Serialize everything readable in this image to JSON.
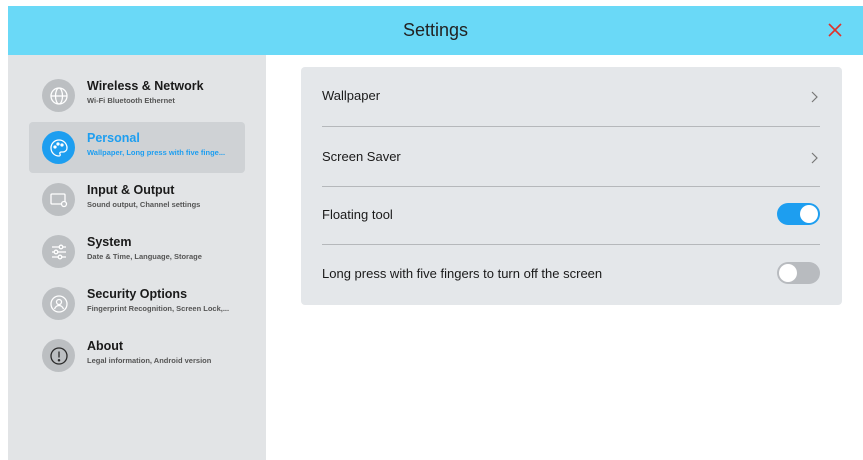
{
  "window": {
    "title": "Settings",
    "close_icon": "close-icon",
    "accent": "#1d9ef0",
    "titlebar_color": "#6ad9f7",
    "close_color": "#e0322b"
  },
  "sidebar": {
    "items": [
      {
        "label": "Wireless & Network",
        "subtitle": "Wi-Fi Bluetooth Ethernet",
        "icon": "globe-icon",
        "active": false
      },
      {
        "label": "Personal",
        "subtitle": "Wallpaper, Long press with five finge...",
        "icon": "palette-icon",
        "active": true
      },
      {
        "label": "Input & Output",
        "subtitle": "Sound output, Channel settings",
        "icon": "monitor-settings-icon",
        "active": false
      },
      {
        "label": "System",
        "subtitle": "Date & Time, Language, Storage",
        "icon": "sliders-icon",
        "active": false
      },
      {
        "label": "Security Options",
        "subtitle": "Fingerprint Recognition, Screen Lock,...",
        "icon": "user-lock-icon",
        "active": false
      },
      {
        "label": "About",
        "subtitle": "Legal information, Android version",
        "icon": "info-icon",
        "active": false
      }
    ]
  },
  "main": {
    "rows": [
      {
        "label": "Wallpaper",
        "control": "chevron"
      },
      {
        "label": "Screen Saver",
        "control": "chevron"
      },
      {
        "label": "Floating tool",
        "control": "toggle",
        "on": true
      },
      {
        "label": "Long press with five fingers to turn off the screen",
        "control": "toggle",
        "on": false
      }
    ]
  }
}
